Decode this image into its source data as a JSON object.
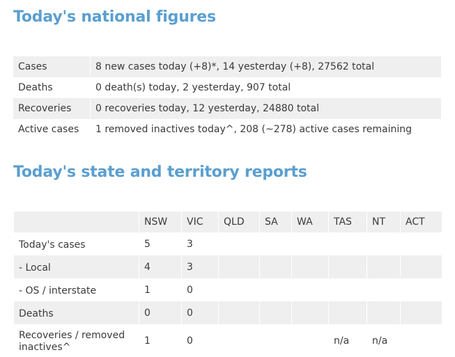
{
  "national": {
    "title": "Today's national figures",
    "rows": [
      {
        "label": "Cases",
        "value": "8 new cases today (+8)*, 14 yesterday (+8), 27562 total"
      },
      {
        "label": "Deaths",
        "value": "0 death(s) today, 2 yesterday, 907 total"
      },
      {
        "label": "Recoveries",
        "value": "0 recoveries today, 12 yesterday, 24880 total"
      },
      {
        "label": "Active cases",
        "value": "1 removed inactives today^, 208 (~278) active cases remaining"
      }
    ]
  },
  "states": {
    "title": "Today's state and territory reports",
    "headers": [
      "",
      "NSW",
      "VIC",
      "QLD",
      "SA",
      "WA",
      "TAS",
      "NT",
      "ACT"
    ],
    "rows": [
      {
        "label": "Today's cases",
        "cells": [
          "5",
          "3",
          "",
          "",
          "",
          "",
          "",
          ""
        ]
      },
      {
        "label": "- Local",
        "cells": [
          "4",
          "3",
          "",
          "",
          "",
          "",
          "",
          ""
        ]
      },
      {
        "label": "- OS / interstate",
        "cells": [
          "1",
          "0",
          "",
          "",
          "",
          "",
          "",
          ""
        ]
      },
      {
        "label": "Deaths",
        "cells": [
          "0",
          "0",
          "",
          "",
          "",
          "",
          "",
          ""
        ]
      },
      {
        "label": "Recoveries / removed inactives^",
        "cells": [
          "1",
          "0",
          "",
          "",
          "",
          "n/a",
          "n/a",
          ""
        ]
      }
    ]
  }
}
